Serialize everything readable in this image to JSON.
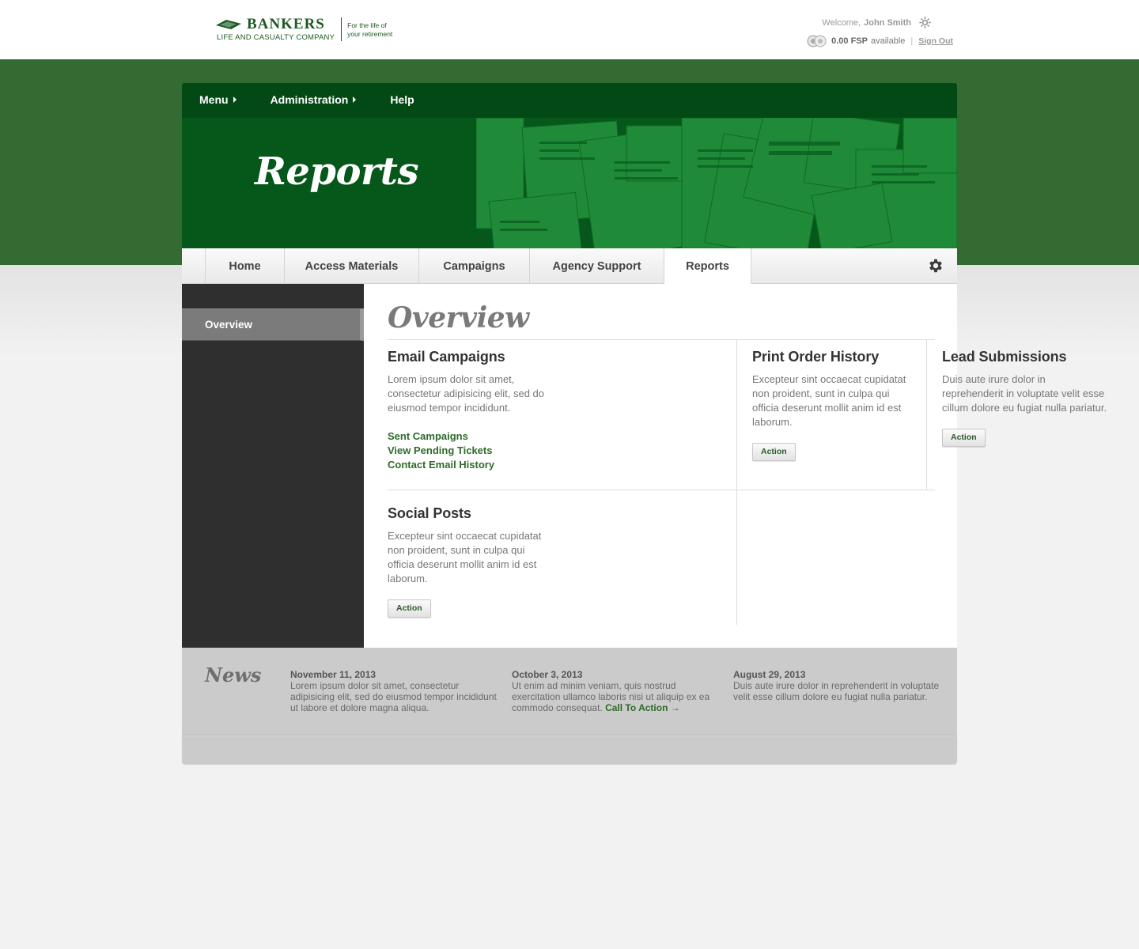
{
  "header": {
    "brand": "BANKERS",
    "brand_sub": "LIFE AND CASUALTY COMPANY",
    "tagline_1": "For the life of",
    "tagline_2": "your retirement",
    "welcome_prefix": "Welcome,",
    "user_name": "John Smith",
    "fsp_value": "0.00 FSP",
    "fsp_suffix": "available",
    "separator": "|",
    "sign_out": "Sign Out"
  },
  "topnav": {
    "items": [
      {
        "label": "Menu",
        "has_arrow": true
      },
      {
        "label": "Administration",
        "has_arrow": true
      },
      {
        "label": "Help",
        "has_arrow": false
      }
    ]
  },
  "hero": {
    "title": "Reports"
  },
  "tabs": {
    "items": [
      {
        "label": "Home"
      },
      {
        "label": "Access Materials"
      },
      {
        "label": "Campaigns"
      },
      {
        "label": "Agency Support"
      },
      {
        "label": "Reports",
        "active": true
      }
    ],
    "settings_icon": "gear-icon"
  },
  "sidebar": {
    "items": [
      {
        "label": "Overview",
        "active": true
      }
    ]
  },
  "main": {
    "title": "Overview",
    "cards": [
      {
        "title": "Email Campaigns",
        "text": "Lorem ipsum dolor sit amet, consectetur adipisicing elit, sed do eiusmod tempor incididunt.",
        "links": [
          "Sent Campaigns",
          "View Pending Tickets",
          "Contact Email History"
        ]
      },
      {
        "title": "Print Order History",
        "text": "Excepteur sint occaecat cupidatat non proident, sunt in culpa qui officia deserunt mollit anim id est laborum.",
        "button": "Action"
      },
      {
        "title": "Lead Submissions",
        "text": "Duis aute irure dolor in reprehenderit in voluptate velit esse cillum dolore eu fugiat nulla pariatur.",
        "button": "Action"
      },
      {
        "title": "Social Posts",
        "text": "Excepteur sint occaecat cupidatat non proident, sunt in culpa qui officia deserunt mollit anim id est laborum.",
        "button": "Action"
      }
    ]
  },
  "news": {
    "title": "News",
    "items": [
      {
        "date": "November 11, 2013",
        "text": "Lorem ipsum dolor sit amet, consectetur adipisicing elit, sed do eiusmod tempor incididunt ut labore et dolore magna aliqua."
      },
      {
        "date": "October 3, 2013",
        "text": "Ut enim ad minim veniam, quis nostrud exercitation ullamco laboris nisi ut aliquip ex ea commodo consequat.",
        "cta": "Call To Action →"
      },
      {
        "date": "August 29, 2013",
        "text": "Duis aute irure dolor in reprehenderit in voluptate velit esse cillum dolore eu fugiat nulla pariatur."
      }
    ]
  },
  "colors": {
    "brand_green": "#1d5a22",
    "band_green": "#346b33",
    "hero_green": "#06581a",
    "link_green": "#2f6a2a",
    "sidebar_dark": "#2f2f2f",
    "news_grey": "#cbcbcb"
  }
}
